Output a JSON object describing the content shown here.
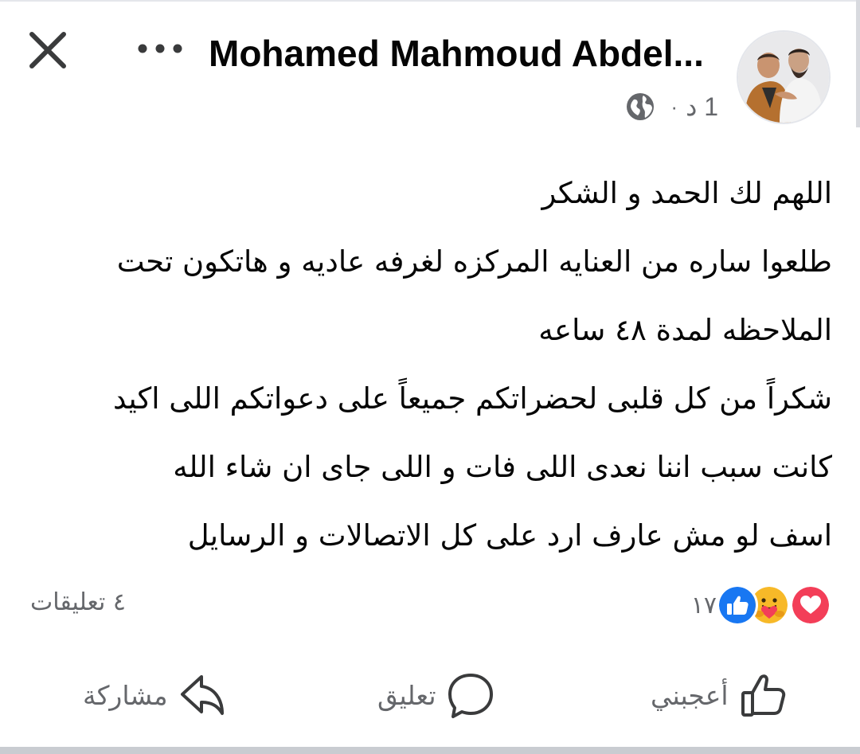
{
  "header": {
    "author_name": "Mohamed Mahmoud Abdel...",
    "time": "1 د",
    "separator": "·",
    "close_icon": "close-icon",
    "more_icon": "more-horizontal-icon",
    "privacy_icon": "globe-icon"
  },
  "post": {
    "lines": [
      "اللهم لك الحمد و الشكر",
      "طلعوا ساره من العنايه المركزه لغرفه عاديه و هاتكون تحت",
      "الملاحظه لمدة ٤٨ ساعه",
      "شكراً من كل قلبى لحضراتكم جميعاً على دعواتكم اللى اكيد",
      "كانت سبب اننا نعدى اللى فات و اللى جاى ان شاء الله",
      "اسف لو مش عارف ارد على كل الاتصالات و الرسايل"
    ]
  },
  "stats": {
    "reaction_count": "١٧",
    "reactions": [
      "like",
      "care",
      "love"
    ],
    "comments": "٤ تعليقات"
  },
  "actions": {
    "like": "أعجبني",
    "comment": "تعليق",
    "share": "مشاركة"
  },
  "colors": {
    "text": "#050505",
    "secondary": "#65676b",
    "like_blue": "#1877f2",
    "love_red": "#f33e58",
    "care_yellow": "#f7b928"
  }
}
